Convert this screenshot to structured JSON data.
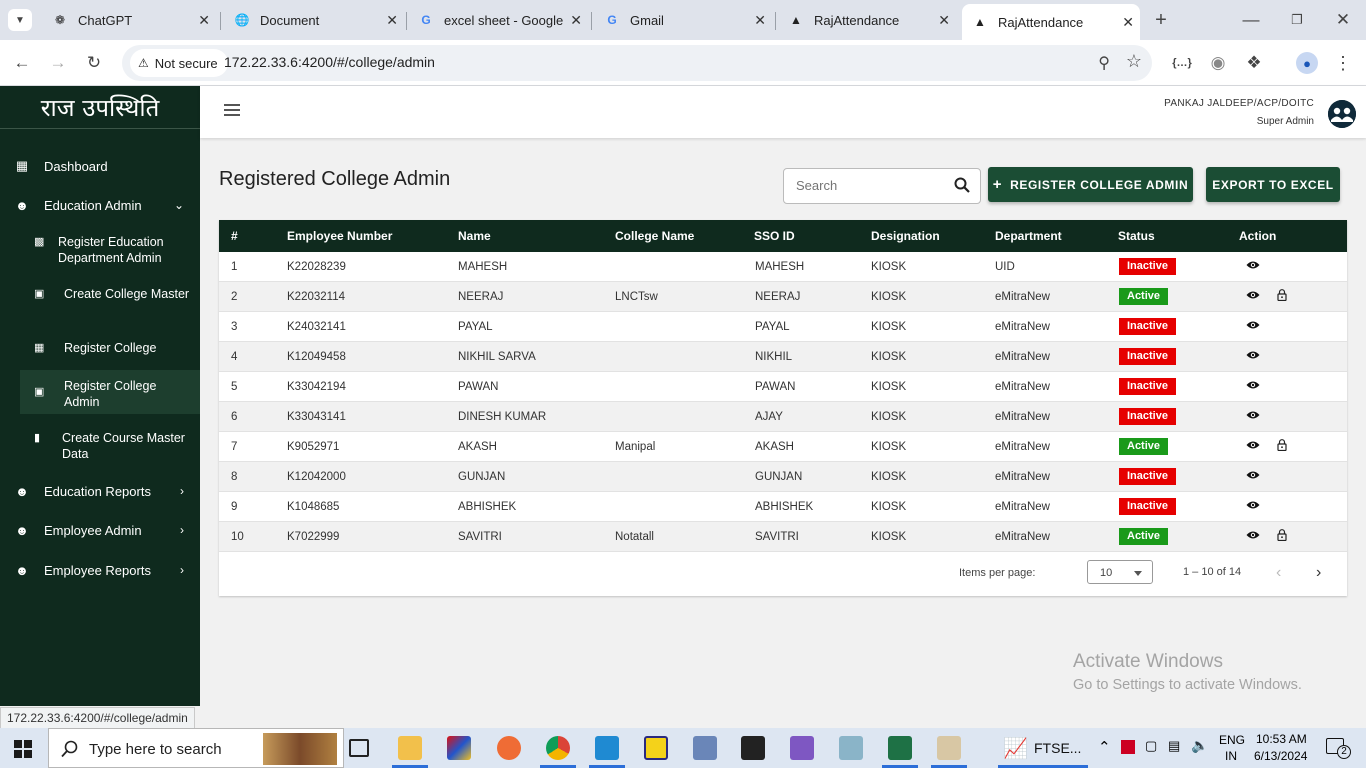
{
  "browser": {
    "tabs": [
      {
        "title": "ChatGPT",
        "icon": "chatgpt-icon"
      },
      {
        "title": "Document",
        "icon": "globe-icon"
      },
      {
        "title": "excel sheet - Google",
        "icon": "google-icon"
      },
      {
        "title": "Gmail",
        "icon": "google-icon"
      },
      {
        "title": "RajAttendance",
        "icon": "angular-icon"
      },
      {
        "title": "RajAttendance",
        "icon": "angular-icon"
      }
    ],
    "security_label": "Not secure",
    "url": "172.22.33.6:4200/#/college/admin",
    "status_url": "172.22.33.6:4200/#/college/admin"
  },
  "sidebar": {
    "brand": "राज उपस्थिति",
    "items": [
      {
        "label": "Dashboard"
      },
      {
        "label": "Education Admin"
      },
      {
        "label": "Education Reports"
      },
      {
        "label": "Employee Admin"
      },
      {
        "label": "Employee Reports"
      }
    ],
    "subitems": [
      {
        "label": "Register Education Department Admin"
      },
      {
        "label": "Create College Master"
      },
      {
        "label": "Register College"
      },
      {
        "label": "Register College Admin"
      },
      {
        "label": "Create Course Master Data"
      }
    ]
  },
  "header": {
    "user_name": "PANKAJ JALDEEP/ACP/DOITC",
    "user_role": "Super Admin"
  },
  "main": {
    "title": "Registered College Admin",
    "search_placeholder": "Search",
    "register_button": "REGISTER COLLEGE ADMIN",
    "register_prefix": "+",
    "export_button": "EXPORT TO EXCEL",
    "columns": [
      "#",
      "Employee Number",
      "Name",
      "College Name",
      "SSO ID",
      "Designation",
      "Department",
      "Status",
      "Action"
    ],
    "rows": [
      {
        "no": "1",
        "emp": "K22028239",
        "name": "MAHESH",
        "college": "",
        "sso": "MAHESH",
        "desig": "KIOSK",
        "dept": "UID",
        "status": "Inactive"
      },
      {
        "no": "2",
        "emp": "K22032114",
        "name": "NEERAJ",
        "college": "LNCTsw",
        "sso": "NEERAJ",
        "desig": "KIOSK",
        "dept": "eMitraNew",
        "status": "Active"
      },
      {
        "no": "3",
        "emp": "K24032141",
        "name": "PAYAL",
        "college": "",
        "sso": "PAYAL",
        "desig": "KIOSK",
        "dept": "eMitraNew",
        "status": "Inactive"
      },
      {
        "no": "4",
        "emp": "K12049458",
        "name": "NIKHIL SARVA",
        "college": "",
        "sso": "NIKHIL",
        "desig": "KIOSK",
        "dept": "eMitraNew",
        "status": "Inactive"
      },
      {
        "no": "5",
        "emp": "K33042194",
        "name": "PAWAN",
        "college": "",
        "sso": "PAWAN",
        "desig": "KIOSK",
        "dept": "eMitraNew",
        "status": "Inactive"
      },
      {
        "no": "6",
        "emp": "K33043141",
        "name": "DINESH KUMAR",
        "college": "",
        "sso": "AJAY",
        "desig": "KIOSK",
        "dept": "eMitraNew",
        "status": "Inactive"
      },
      {
        "no": "7",
        "emp": "K9052971",
        "name": "AKASH",
        "college": "Manipal",
        "sso": "AKASH",
        "desig": "KIOSK",
        "dept": "eMitraNew",
        "status": "Active"
      },
      {
        "no": "8",
        "emp": "K12042000",
        "name": "GUNJAN",
        "college": "",
        "sso": "GUNJAN",
        "desig": "KIOSK",
        "dept": "eMitraNew",
        "status": "Inactive"
      },
      {
        "no": "9",
        "emp": "K1048685",
        "name": "ABHISHEK",
        "college": "",
        "sso": "ABHISHEK",
        "desig": "KIOSK",
        "dept": "eMitraNew",
        "status": "Inactive"
      },
      {
        "no": "10",
        "emp": "K7022999",
        "name": "SAVITRI",
        "college": "Notatall",
        "sso": "SAVITRI",
        "desig": "KIOSK",
        "dept": "eMitraNew",
        "status": "Active"
      }
    ],
    "paginator": {
      "items_per_page_label": "Items per page:",
      "items_per_page": "10",
      "range": "1 – 10 of 14"
    }
  },
  "watermark": {
    "line1": "Activate Windows",
    "line2": "Go to Settings to activate Windows."
  },
  "taskbar": {
    "search_placeholder": "Type here to search",
    "app_label": "FTSE...",
    "lang1": "ENG",
    "lang2": "IN",
    "time": "10:53 AM",
    "date": "6/13/2024",
    "notif_count": "2"
  },
  "colors": {
    "sidebar_bg": "#0f2a1e",
    "accent_green": "#1b4d34",
    "active_badge": "#1a9a1a",
    "inactive_badge": "#e60000"
  }
}
